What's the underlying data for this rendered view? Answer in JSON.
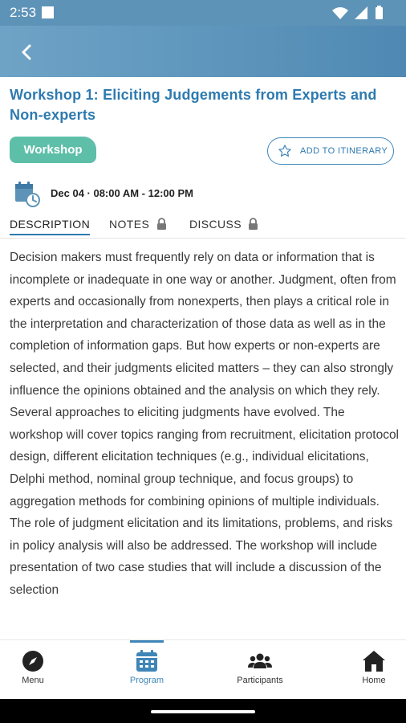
{
  "status_bar": {
    "time": "2:53"
  },
  "header": {
    "back_icon": "chevron-left-icon"
  },
  "event": {
    "title": "Workshop 1: Eliciting Judgements from Experts and Non-experts",
    "type_badge": "Workshop",
    "add_itinerary_label": "ADD TO ITINERARY",
    "date_time": "Dec 04 · 08:00 AM - 12:00 PM"
  },
  "tabs": [
    {
      "label": "DESCRIPTION",
      "active": true
    },
    {
      "label": "NOTES",
      "locked": true
    },
    {
      "label": "DISCUSS",
      "locked": true
    }
  ],
  "description": "Decision makers must frequently rely on data or information that is incomplete or inadequate in one way or another. Judgment, often from experts and occasionally from nonexperts, then plays a critical role in the interpretation and characterization of those data as well as in the completion of information gaps. But how experts or non-experts are selected, and their judgments elicited matters – they can also strongly influence the opinions obtained and the analysis on which they rely. Several approaches to eliciting judgments have evolved. The workshop will cover topics ranging from recruitment, elicitation protocol design, different elicitation techniques (e.g., individual elicitations, Delphi method, nominal group technique, and focus groups) to aggregation methods for combining opinions of multiple individuals. The role of judgment elicitation and its limitations, problems, and risks in policy analysis will also be addressed. The workshop will include presentation of two case studies that will include a discussion of the selection",
  "bottom_nav": [
    {
      "label": "Menu",
      "icon": "compass-icon"
    },
    {
      "label": "Program",
      "icon": "calendar-icon",
      "active": true
    },
    {
      "label": "Participants",
      "icon": "people-icon"
    },
    {
      "label": "Home",
      "icon": "home-icon"
    }
  ],
  "colors": {
    "header": "#5e93b8",
    "title": "#2d7ab0",
    "badge": "#5ebfa9",
    "active_nav": "#3f86b8"
  }
}
